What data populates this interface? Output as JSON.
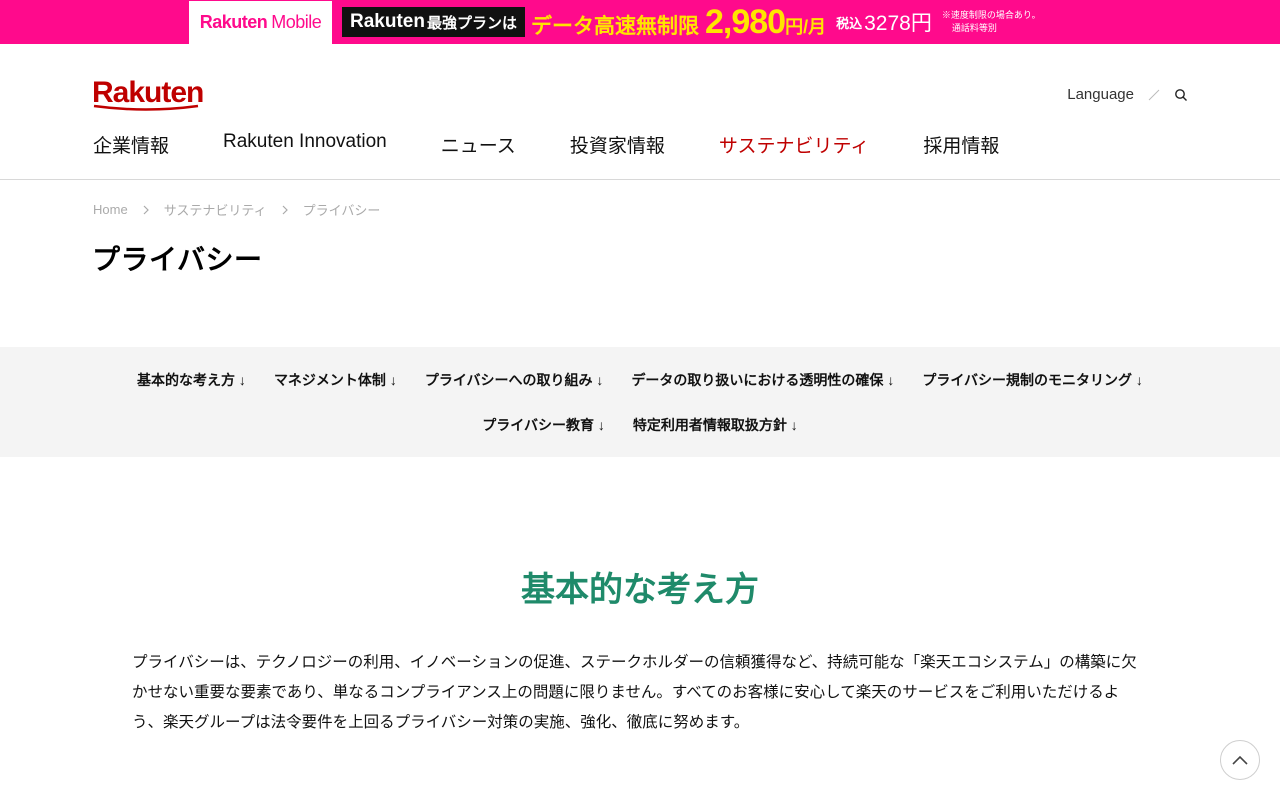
{
  "promo": {
    "brand_a": "Rakuten",
    "brand_b": "Mobile",
    "plan_main": "Rakuten",
    "plan_rest": "最強プランは",
    "headline": "データ高速無制限",
    "price": "2,980",
    "unit": "円/月",
    "tax_label": "税込",
    "tax_price": "3278円",
    "note_line1": "※速度制限の場合あり。",
    "note_line2": "通話料等別",
    "colors": {
      "background": "#ff0a8c",
      "accent": "#ffe400"
    }
  },
  "header": {
    "logo_text": "Rakuten",
    "language_label": "Language",
    "nav": [
      {
        "label": "企業情報"
      },
      {
        "label": "Rakuten Innovation"
      },
      {
        "label": "ニュース"
      },
      {
        "label": "投資家情報"
      },
      {
        "label": "サステナビリティ"
      },
      {
        "label": "採用情報"
      }
    ]
  },
  "breadcrumb": {
    "items": [
      {
        "label": "Home"
      },
      {
        "label": "サステナビリティ"
      },
      {
        "label": "プライバシー"
      }
    ]
  },
  "page_title": "プライバシー",
  "anchors": {
    "row1": [
      {
        "label": "基本的な考え方 ↓"
      },
      {
        "label": "マネジメント体制 ↓"
      },
      {
        "label": "プライバシーへの取り組み ↓"
      },
      {
        "label": "データの取り扱いにおける透明性の確保 ↓"
      },
      {
        "label": "プライバシー規制のモニタリング ↓"
      }
    ],
    "row2": [
      {
        "label": "プライバシー教育 ↓"
      },
      {
        "label": "特定利用者情報取扱方針 ↓"
      }
    ]
  },
  "section": {
    "title": "基本的な考え方",
    "body": "プライバシーは、テクノロジーの利用、イノベーションの促進、ステークホルダーの信頼獲得など、持続可能な「楽天エコシステム」の構築に欠かせない重要な要素であり、単なるコンプライアンス上の問題に限りません。すべてのお客様に安心して楽天のサービスをご利用いただけるよう、楽天グループは法令要件を上回るプライバシー対策の実施、強化、徹底に努めます。"
  },
  "colors": {
    "brand_red": "#bf0000",
    "section_green": "#1f8a6a",
    "band_gray": "#f4f4f4"
  },
  "icons": {
    "search": "search-icon",
    "back_to_top": "chevron-up-icon",
    "breadcrumb_separator": "chevron-right-icon"
  }
}
